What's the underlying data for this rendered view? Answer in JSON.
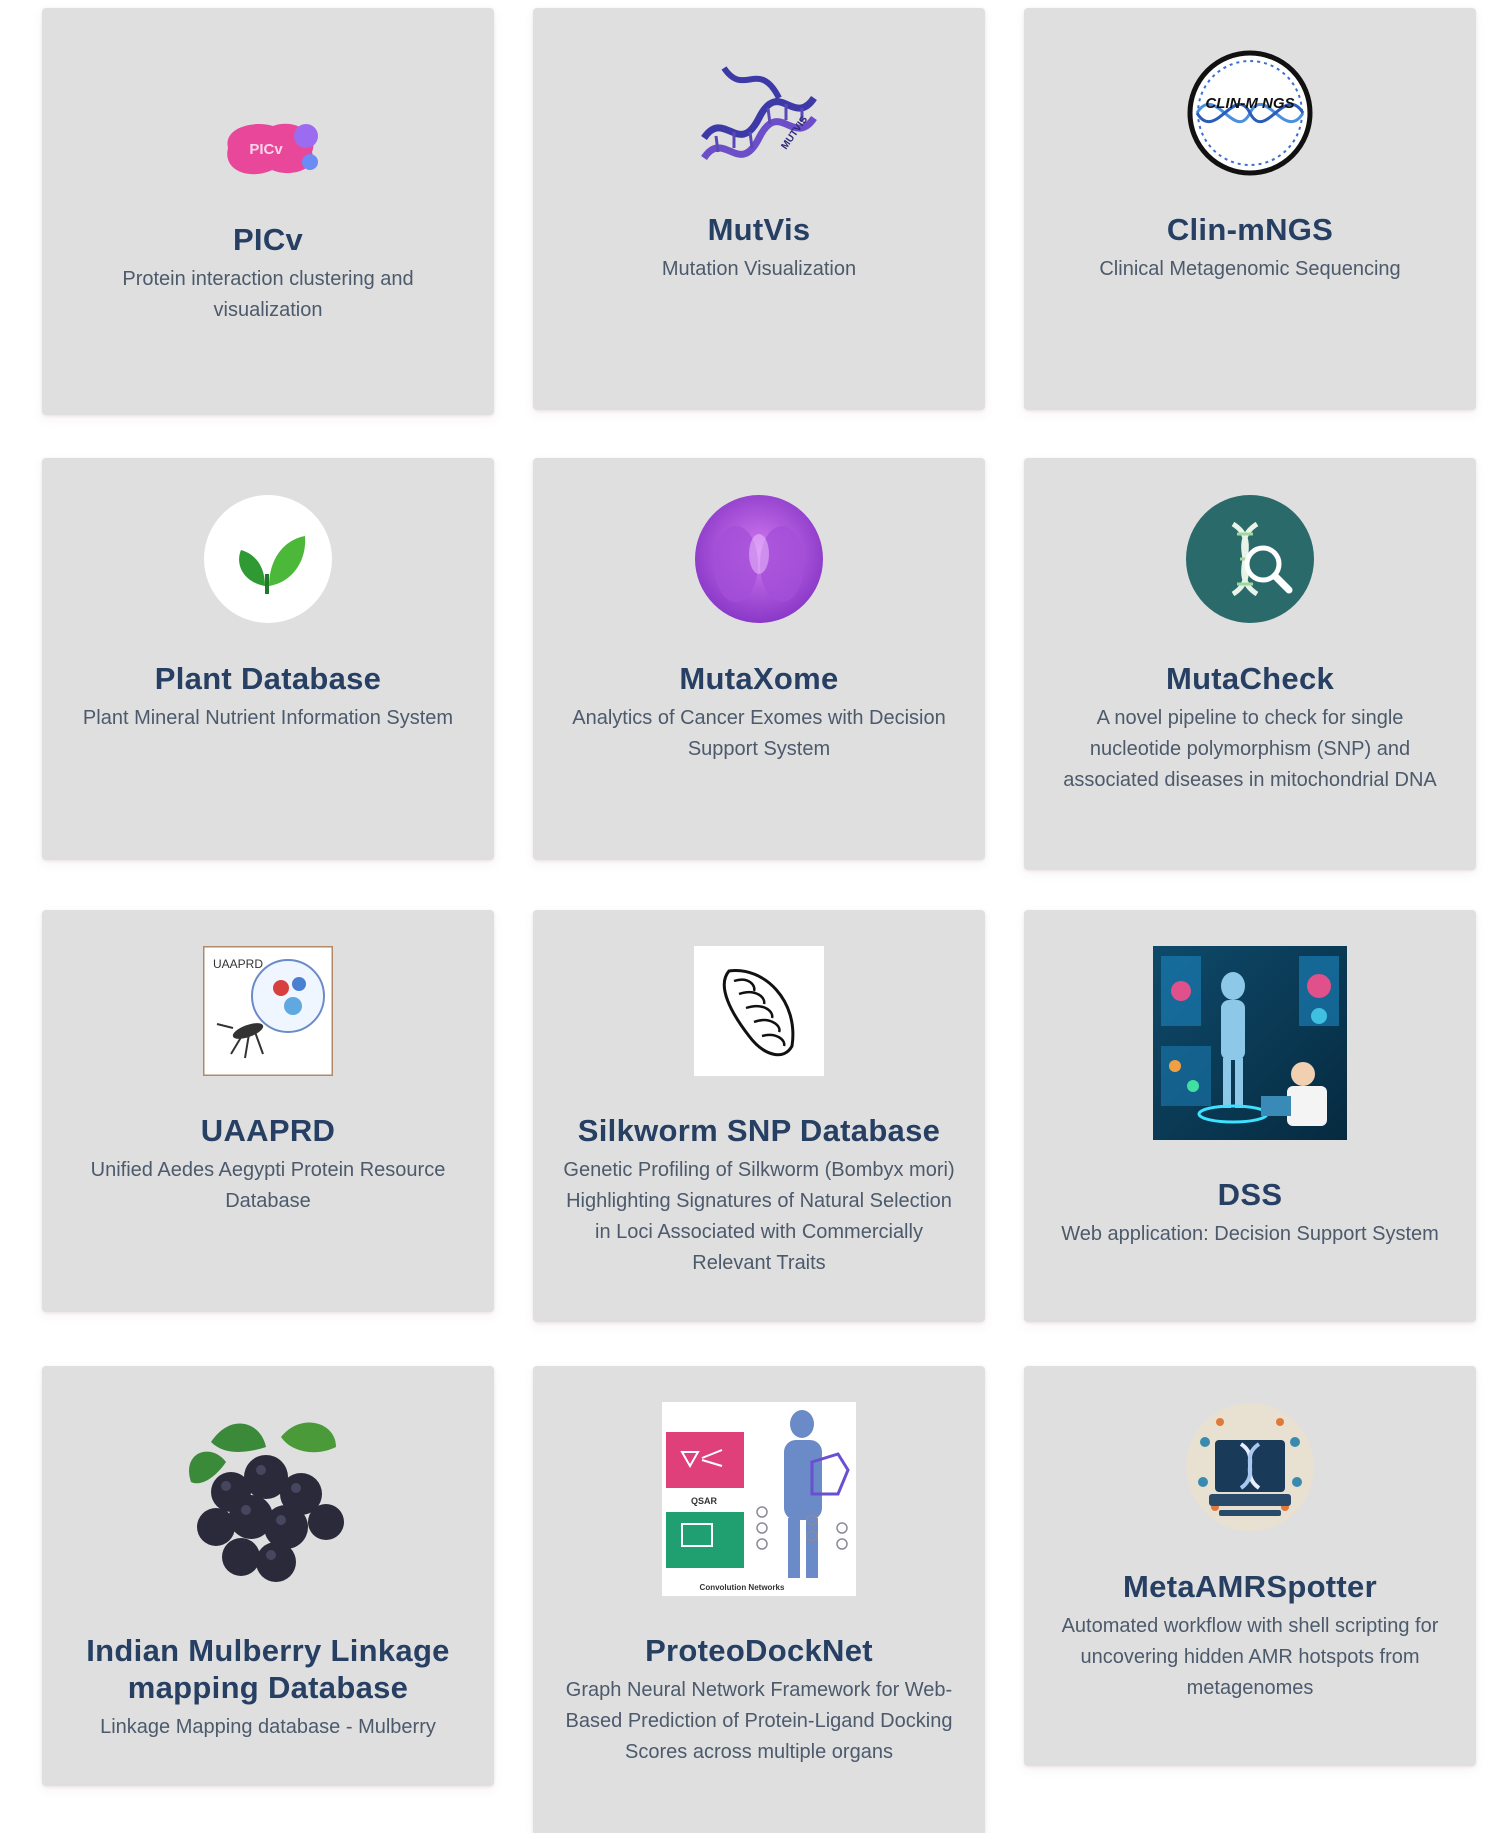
{
  "cards": [
    {
      "title": "PICv",
      "description": "Protein interaction clustering and visualization",
      "logo_text": "PICv"
    },
    {
      "title": "MutVis",
      "description": "Mutation Visualization",
      "logo_text": "MUTVIS"
    },
    {
      "title": "Clin-mNGS",
      "description": "Clinical Metagenomic Sequencing",
      "logo_text": "CLIN-M NGS"
    },
    {
      "title": "Plant Database",
      "description": "Plant Mineral Nutrient Information System"
    },
    {
      "title": "MutaXome",
      "description": "Analytics of Cancer Exomes with Decision Support System"
    },
    {
      "title": "MutaCheck",
      "description": "A novel pipeline to check for single nucleotide polymorphism (SNP) and associated diseases in mitochondrial DNA"
    },
    {
      "title": "UAAPRD",
      "description": "Unified Aedes Aegypti Protein Resource Database",
      "logo_text": "UAAPRD"
    },
    {
      "title": "Silkworm SNP Database",
      "description": "Genetic Profiling of Silkworm (Bombyx mori) Highlighting Signatures of Natural Selection in Loci Associated with Commercially Relevant Traits"
    },
    {
      "title": "DSS",
      "description": "Web application: Decision Support System"
    },
    {
      "title": "Indian Mulberry Linkage mapping Database",
      "description": "Linkage Mapping database - Mulberry"
    },
    {
      "title": "ProteoDockNet",
      "description": "Graph Neural Network Framework for Web-Based Prediction of Protein-Ligand Docking Scores across multiple organs",
      "logo_text_1": "QSAR",
      "logo_text_2": "Convolution Networks"
    },
    {
      "title": "MetaAMRSpotter",
      "description": "Automated workflow with shell scripting for uncovering hidden AMR hotspots from metagenomes"
    }
  ],
  "colors": {
    "card_background": "#dfdfdf",
    "title": "#263f63",
    "description": "#4c5a6c"
  }
}
